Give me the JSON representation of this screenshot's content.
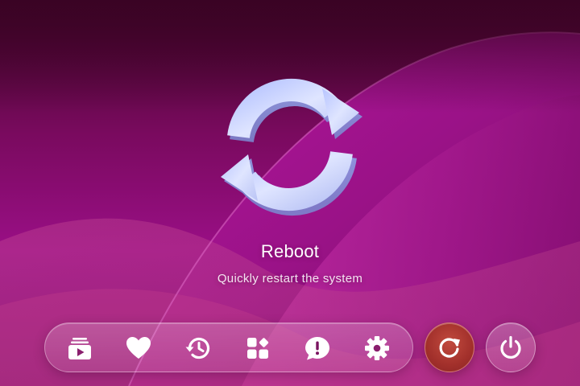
{
  "hero": {
    "icon": "reboot-arrows-icon",
    "title": "Reboot",
    "subtitle": "Quickly restart the system"
  },
  "dock": {
    "items": [
      {
        "icon": "playlist-play-icon"
      },
      {
        "icon": "heart-icon"
      },
      {
        "icon": "history-icon"
      },
      {
        "icon": "apps-grid-icon"
      },
      {
        "icon": "feedback-alert-icon"
      },
      {
        "icon": "gear-icon"
      }
    ]
  },
  "actions": {
    "reboot": {
      "icon": "restart-icon",
      "selected": true,
      "color": "#a2302b"
    },
    "power": {
      "icon": "power-icon",
      "selected": false
    }
  },
  "colors": {
    "background_dark": "#4a0533",
    "background_accent": "#b0179b",
    "hero_icon": "#d6dcff",
    "accent": "#a2302b",
    "text": "#ffffff"
  }
}
